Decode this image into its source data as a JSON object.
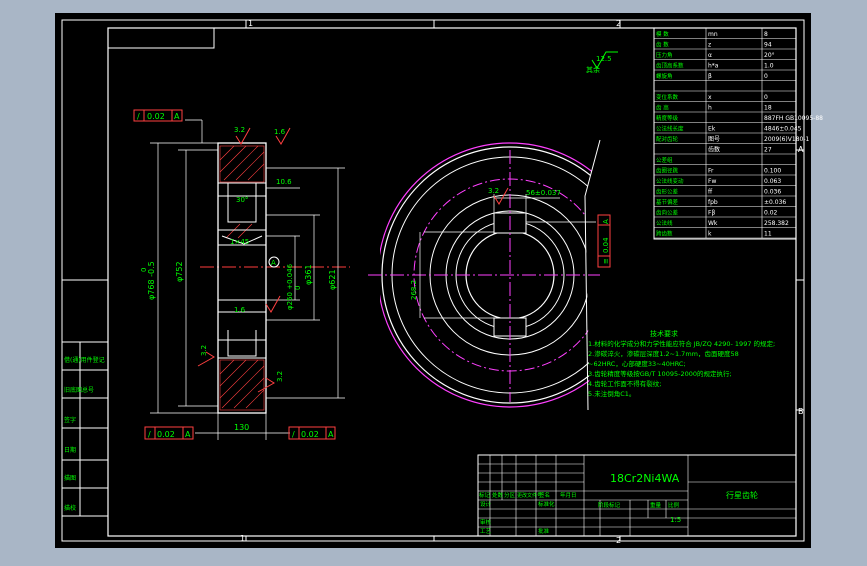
{
  "frame": {
    "zone_top": [
      "1",
      "2"
    ],
    "zone_bottom": [
      "1",
      "2"
    ],
    "zone_right": [
      "A",
      "B"
    ]
  },
  "roughness": {
    "global": "12.5",
    "global_note": "其余",
    "values": [
      "3.2",
      "1.6",
      "1.6",
      "3.2",
      "3.2",
      "3.2"
    ]
  },
  "tolerances": {
    "top": {
      "sym": "/",
      "val": "0.02",
      "ref": "A"
    },
    "bottom_left": {
      "sym": "/",
      "val": "0.02",
      "ref": "A"
    },
    "bottom_right": {
      "sym": "/",
      "val": "0.02",
      "ref": "A"
    },
    "keyway": {
      "sym": "≡",
      "val": "0.04",
      "ref": "A"
    }
  },
  "dimensions": {
    "d768": "φ768 -0.5",
    "d768_top": "0",
    "d752": "φ752",
    "d621": "φ621",
    "d361": "φ361",
    "d250": "φ250 +0.046",
    "d250_top": "0",
    "d10_6": "10.6",
    "d30": "30°",
    "chamfer": "1×45",
    "width": "130",
    "datum": "A",
    "keyslot": "56±0.037",
    "radius": "268.2"
  },
  "param_table": {
    "rows": [
      {
        "name": "模  数",
        "sym": "mn",
        "val": "8"
      },
      {
        "name": "齿  数",
        "sym": "z",
        "val": "94"
      },
      {
        "name": "压力角",
        "sym": "α",
        "val": "20°"
      },
      {
        "name": "齿顶高系数",
        "sym": "h*a",
        "val": "1.0"
      },
      {
        "name": "螺旋角",
        "sym": "β",
        "val": "0"
      },
      {
        "name": "",
        "sym": "",
        "val": ""
      },
      {
        "name": "变位系数",
        "sym": "x",
        "val": "0"
      },
      {
        "name": "齿  高",
        "sym": "h",
        "val": "18"
      },
      {
        "name": "精度等级",
        "sym": "",
        "val": "887FH GB10095-88"
      },
      {
        "name": "公法线长度",
        "sym": "Ek",
        "val": "4846±0.045"
      },
      {
        "name": "配对齿轮",
        "sym": "图号",
        "val": "2009(6)V180-1"
      },
      {
        "name": "",
        "sym": "齿数",
        "val": "27"
      },
      {
        "name": "公差组",
        "sym": "",
        "val": ""
      },
      {
        "name": "齿圈径跳",
        "sym": "Fr",
        "val": "0.100"
      },
      {
        "name": "公法线变动",
        "sym": "Fw",
        "val": "0.063"
      },
      {
        "name": "齿形公差",
        "sym": "ff",
        "val": "0.036"
      },
      {
        "name": "基节偏差",
        "sym": "fpb",
        "val": "±0.036"
      },
      {
        "name": "齿向公差",
        "sym": "Fβ",
        "val": "0.02"
      },
      {
        "name": "公法线",
        "sym": "Wk",
        "val": "258.382"
      },
      {
        "name": "跨齿数",
        "sym": "k",
        "val": "11"
      }
    ]
  },
  "tech_req": {
    "title": "技术要求",
    "lines": [
      "1.材料的化学成分和力学性能应符合 JB/ZQ 4290- 1997 的规定;",
      "2.渗碳淬火，渗碳层深度1.2~1.7mm，齿面硬度58",
      "  ~62HRC，心部硬度33~40HRC;",
      "3.齿轮精度等级按GB/T 10095-2000的规定执行;",
      "4.齿轮工作面不得有裂纹;",
      "5.未注倒角C1。"
    ]
  },
  "title_block": {
    "material": "18Cr2Ni4WA",
    "drawing_name": "行星齿轮",
    "scale": "1:5",
    "labels": [
      "标记",
      "处数",
      "分区",
      "更改文件号",
      "签名",
      "年月日",
      "设计",
      "标准化",
      "审核",
      "工艺",
      "批准",
      "阶段标记",
      "重量",
      "比例"
    ]
  },
  "side_labels": [
    "借(通)用件登记",
    "旧底图总号",
    "签字",
    "日期",
    "描图",
    "描校",
    "底图总号"
  ]
}
